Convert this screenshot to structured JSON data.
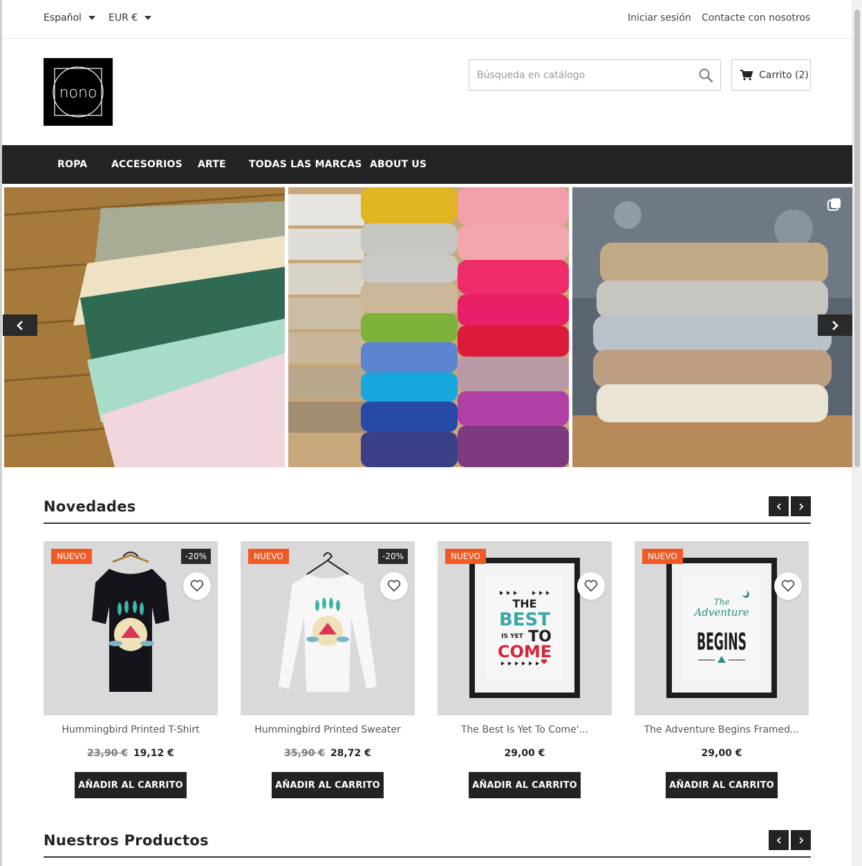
{
  "topbar": {
    "language": "Español",
    "currency": "EUR €",
    "login": "Iniciar sesión",
    "contact": "Contacte con nosotros"
  },
  "header": {
    "logo_text": "nono",
    "search_placeholder": "Búsqueda en catálogo",
    "cart_label": "Carrito (2)"
  },
  "nav": {
    "items": [
      "ROPA",
      "ACCESORIOS",
      "ARTE",
      "TODAS LAS MARCAS",
      "ABOUT US"
    ]
  },
  "sections": {
    "new_title": "Novedades",
    "products_title": "Nuestros Productos"
  },
  "products": [
    {
      "badge": "NUEVO",
      "discount": "-20%",
      "name": "Hummingbird Printed T-Shirt",
      "old_price": "23,90 €",
      "price": "19,12 €",
      "button": "AÑADIR AL CARRITO"
    },
    {
      "badge": "NUEVO",
      "discount": "-20%",
      "name": "Hummingbird Printed Sweater",
      "old_price": "35,90 €",
      "price": "28,72 €",
      "button": "AÑADIR AL CARRITO"
    },
    {
      "badge": "NUEVO",
      "discount": "",
      "name": "The Best Is Yet To Come'...",
      "old_price": "",
      "price": "29,00 €",
      "button": "AÑADIR AL CARRITO"
    },
    {
      "badge": "NUEVO",
      "discount": "",
      "name": "The Adventure Begins Framed...",
      "old_price": "",
      "price": "29,00 €",
      "button": "AÑADIR AL CARRITO"
    }
  ],
  "posters": {
    "best": {
      "line1": "THE",
      "line2": "BEST",
      "line3": "IS YET",
      "line4": "TO",
      "line5": "COME"
    },
    "adventure": {
      "line1": "The",
      "line2": "Adventure",
      "line3": "BEGINS"
    }
  },
  "colors": {
    "accent": "#f15a24",
    "dark": "#232323"
  }
}
